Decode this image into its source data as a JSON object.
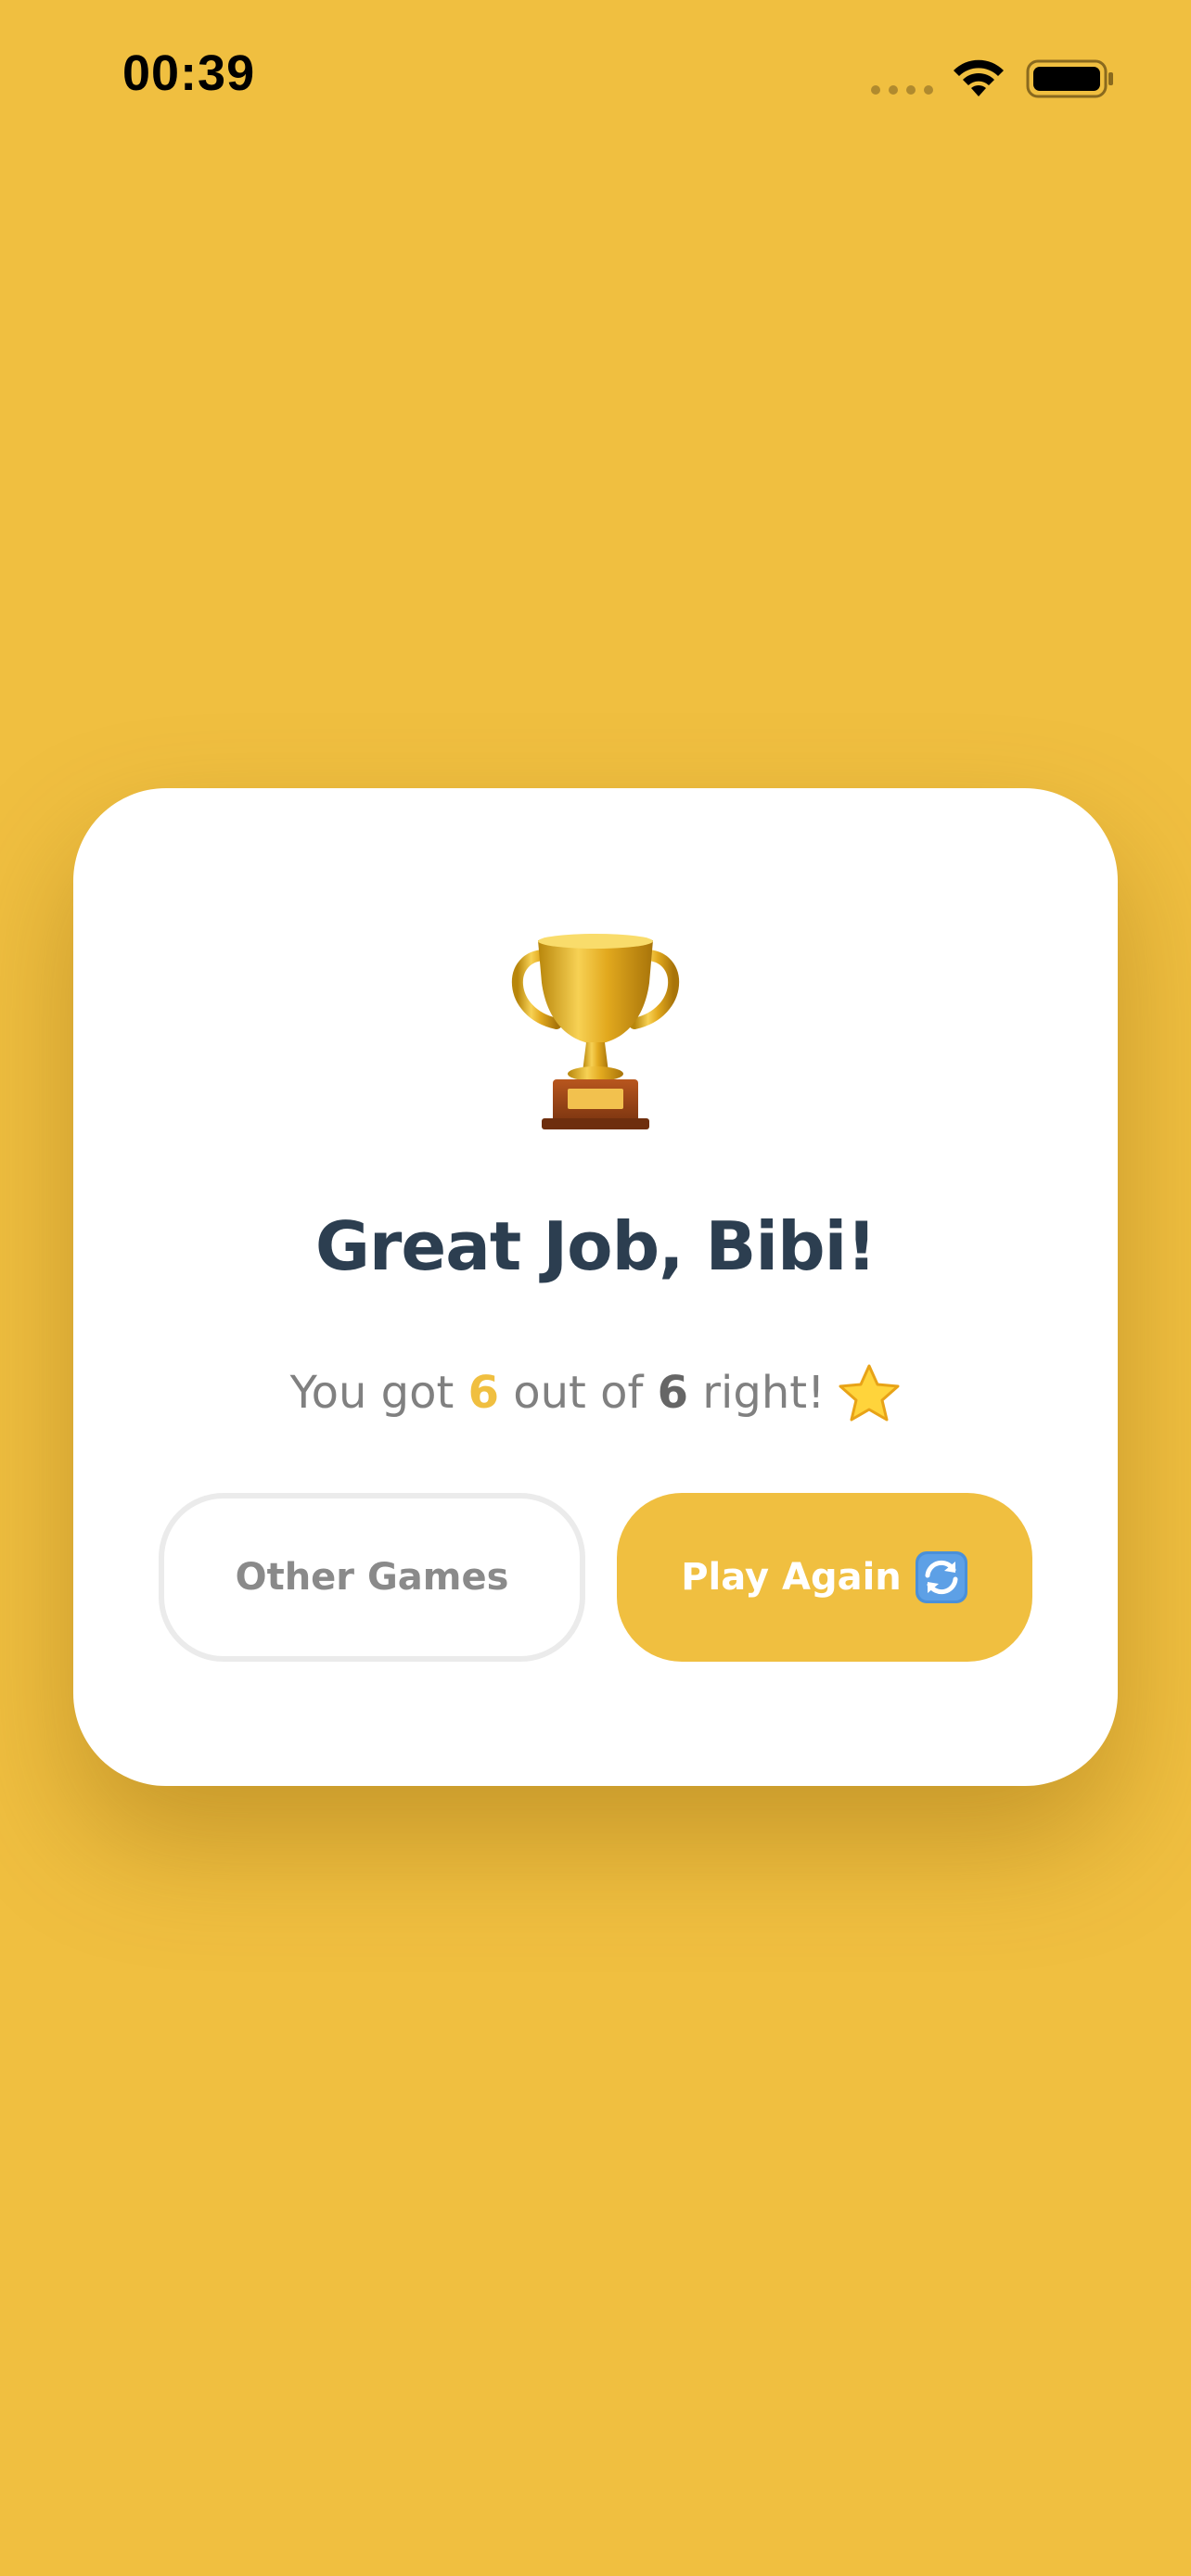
{
  "status_bar": {
    "time": "00:39",
    "icons": [
      "signal-dots-icon",
      "wifi-icon",
      "battery-icon"
    ]
  },
  "result_card": {
    "icon": "trophy-icon",
    "title": "Great Job, Bibi!",
    "score": {
      "prefix": "You got ",
      "value": "6",
      "middle": " out of ",
      "total": "6",
      "suffix": " right!",
      "icon": "star-icon"
    },
    "buttons": {
      "other_games_label": "Other Games",
      "play_again_label": "Play Again",
      "play_again_icon": "replay-icon"
    }
  },
  "colors": {
    "background": "#F0BF40",
    "accent": "#F0BF40",
    "title": "#2C3E50",
    "muted_text": "#808080",
    "card": "#FFFFFF"
  }
}
